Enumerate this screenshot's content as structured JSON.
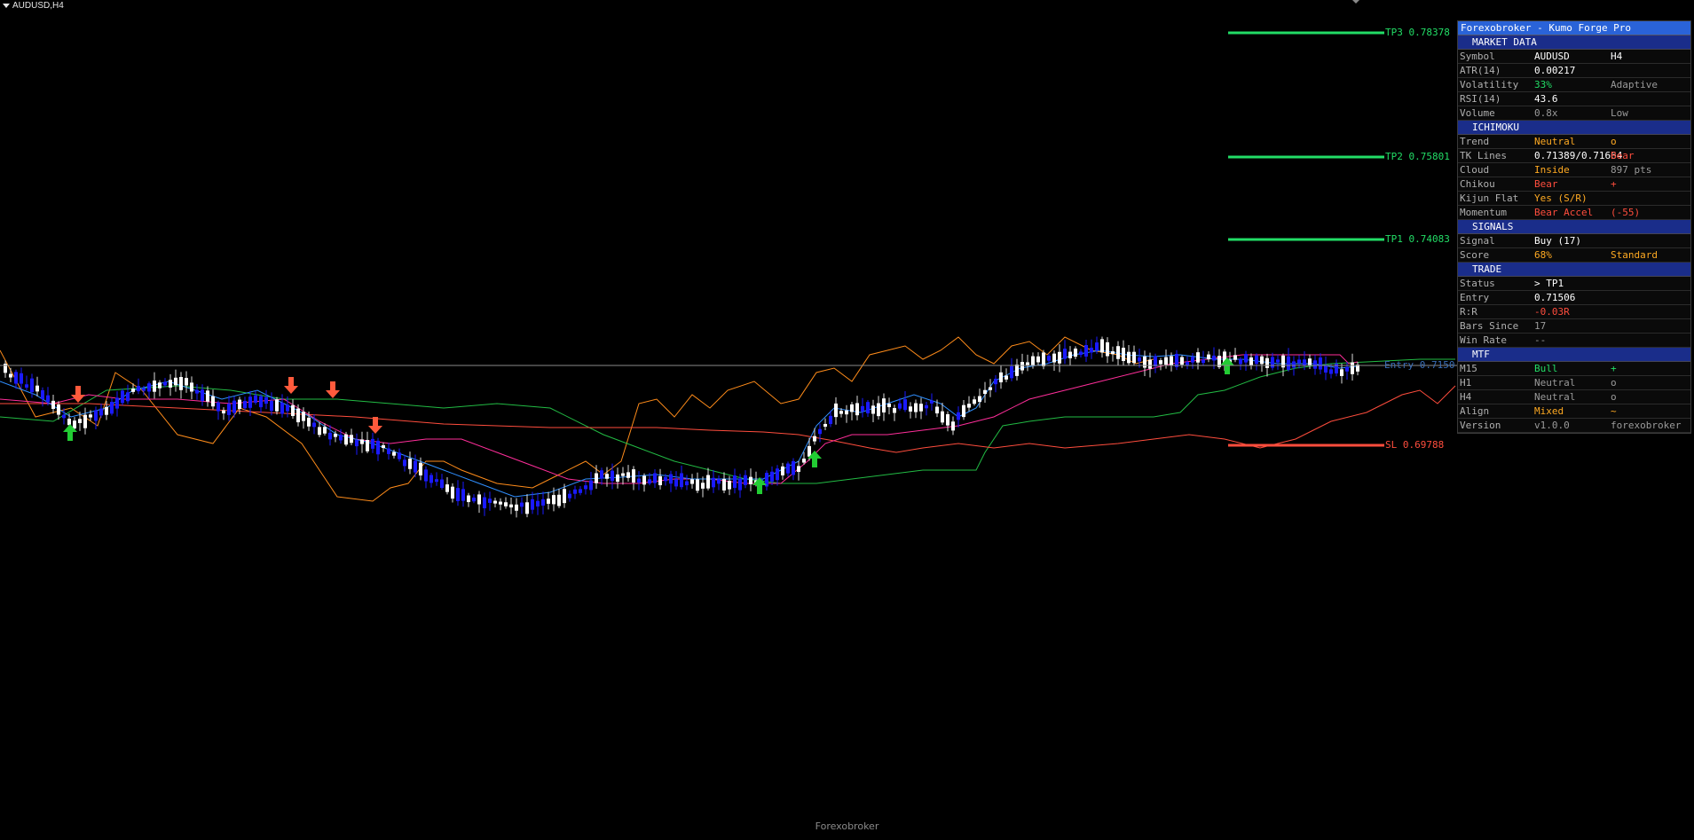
{
  "symbol_tab": {
    "label": "AUDUSD,H4",
    "icon": "triangle-down-icon"
  },
  "footer": "Forexobroker",
  "levels": [
    {
      "key": "tp3",
      "label": "TP3 0.78378",
      "color": "#22dd66"
    },
    {
      "key": "tp2",
      "label": "TP2 0.75801",
      "color": "#22dd66"
    },
    {
      "key": "tp1",
      "label": "TP1 0.74083",
      "color": "#22dd66"
    },
    {
      "key": "entry",
      "label": "Entry 0.7150",
      "color": "#3a6fb8"
    },
    {
      "key": "sl",
      "label": "SL 0.69788",
      "color": "#ff4d3d"
    }
  ],
  "colors": {
    "bull_candle": "#1a1aff",
    "bear_candle": "#ffffff",
    "tenkan": "#2f8fff",
    "kijun": "#ff2e9a",
    "span_a": "#22bb44",
    "span_b": "#ff4d3d",
    "chikou": "#ff8c1a",
    "buy_arrow": "#22cc33",
    "sell_arrow": "#ff5a3c",
    "panel_title": "#2a63d8",
    "panel_section": "#1a2d8a"
  },
  "dashboard": {
    "title": "Forexobroker - Kumo Forge Pro",
    "sections": [
      {
        "title": "MARKET DATA",
        "rows": [
          {
            "label": "Symbol",
            "value": "AUDUSD",
            "value_color": "#ffffff",
            "extra": "H4",
            "extra_color": "#ffffff"
          },
          {
            "label": "ATR(14)",
            "value": "0.00217",
            "value_color": "#ffffff",
            "extra": "",
            "extra_color": "#9a9a9a"
          },
          {
            "label": "Volatility",
            "value": "33%",
            "value_color": "#22dd66",
            "extra": "Adaptive",
            "extra_color": "#9a9a9a"
          },
          {
            "label": "RSI(14)",
            "value": "43.6",
            "value_color": "#ffffff",
            "extra": "",
            "extra_color": "#9a9a9a"
          },
          {
            "label": "Volume",
            "value": "0.8x",
            "value_color": "#9a9a9a",
            "extra": "Low",
            "extra_color": "#9a9a9a"
          }
        ]
      },
      {
        "title": "ICHIMOKU",
        "rows": [
          {
            "label": "Trend",
            "value": "Neutral",
            "value_color": "#ffaa22",
            "extra": "o",
            "extra_color": "#ffaa22"
          },
          {
            "label": "TK Lines",
            "value": "0.71389/0.71664",
            "value_color": "#ffffff",
            "extra": "Bear",
            "extra_color": "#ff4d3d"
          },
          {
            "label": "Cloud",
            "value": "Inside",
            "value_color": "#ffaa22",
            "extra": "897 pts",
            "extra_color": "#9a9a9a"
          },
          {
            "label": "Chikou",
            "value": "Bear",
            "value_color": "#ff4d3d",
            "extra": "+",
            "extra_color": "#ff4d3d"
          },
          {
            "label": "Kijun Flat",
            "value": "Yes (S/R)",
            "value_color": "#ffaa22",
            "extra": "",
            "extra_color": "#9a9a9a"
          },
          {
            "label": "Momentum",
            "value": "Bear Accel",
            "value_color": "#ff4d3d",
            "extra": "(-55)",
            "extra_color": "#ff4d3d"
          }
        ]
      },
      {
        "title": "SIGNALS",
        "rows": [
          {
            "label": "Signal",
            "value": "Buy (17)",
            "value_color": "#ffffff",
            "extra": "",
            "extra_color": "#9a9a9a"
          },
          {
            "label": "Score",
            "value": "68%",
            "value_color": "#ffaa22",
            "extra": "Standard",
            "extra_color": "#ffaa22"
          }
        ]
      },
      {
        "title": "TRADE",
        "rows": [
          {
            "label": "Status",
            "value": "> TP1",
            "value_color": "#ffffff",
            "extra": "",
            "extra_color": "#9a9a9a"
          },
          {
            "label": "Entry",
            "value": "0.71506",
            "value_color": "#ffffff",
            "extra": "",
            "extra_color": "#9a9a9a"
          },
          {
            "label": "R:R",
            "value": "-0.03R",
            "value_color": "#ff4d3d",
            "extra": "",
            "extra_color": "#9a9a9a"
          },
          {
            "label": "Bars Since",
            "value": "17",
            "value_color": "#9a9a9a",
            "extra": "",
            "extra_color": "#9a9a9a"
          },
          {
            "label": "Win Rate",
            "value": "--",
            "value_color": "#9a9a9a",
            "extra": "",
            "extra_color": "#9a9a9a"
          }
        ]
      },
      {
        "title": "MTF",
        "rows": [
          {
            "label": "M15",
            "value": "Bull",
            "value_color": "#22dd66",
            "extra": "+",
            "extra_color": "#22dd66"
          },
          {
            "label": "H1",
            "value": "Neutral",
            "value_color": "#9a9a9a",
            "extra": "o",
            "extra_color": "#9a9a9a"
          },
          {
            "label": "H4",
            "value": "Neutral",
            "value_color": "#9a9a9a",
            "extra": "o",
            "extra_color": "#9a9a9a"
          },
          {
            "label": "Align",
            "value": "Mixed",
            "value_color": "#ffaa22",
            "extra": "~",
            "extra_color": "#ffaa22"
          },
          {
            "label": "Version",
            "value": "v1.0.0",
            "value_color": "#9a9a9a",
            "extra": "forexobroker",
            "extra_color": "#9a9a9a"
          }
        ]
      }
    ]
  }
}
